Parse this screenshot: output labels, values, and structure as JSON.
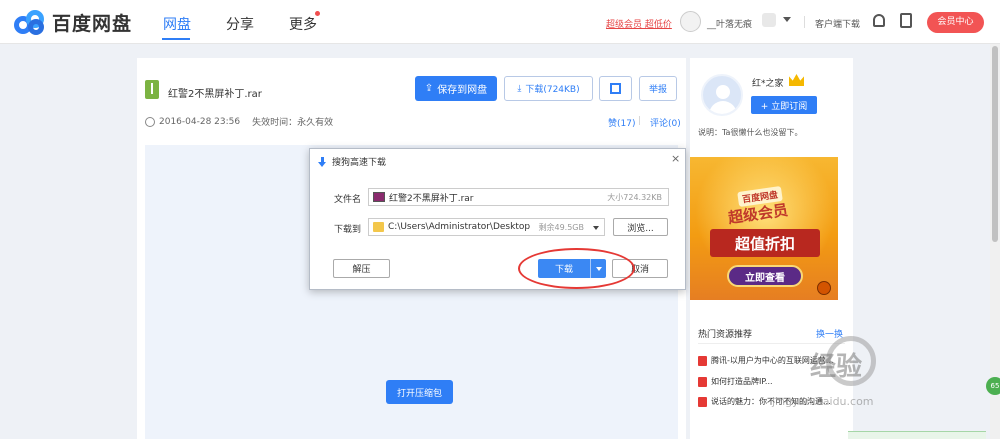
{
  "header": {
    "logo_text": "百度网盘",
    "tabs": [
      {
        "label": "网盘"
      },
      {
        "label": "分享"
      },
      {
        "label": "更多"
      }
    ],
    "vip_link": "超级会员 超低价",
    "username": "__叶落无痕",
    "client_download": "客户端下载",
    "vip_center": "会员中心"
  },
  "file": {
    "title": "红警2不黑屏补丁.rar",
    "save_button": "保存到网盘",
    "download_button": "下载(724KB)",
    "report_button": "举报",
    "date": "2016-04-28 23:56",
    "expiry": "失效时间：永久有效",
    "likes": "赞(17)",
    "comments": "评论(0)",
    "open_zip": "打开压缩包"
  },
  "dialog": {
    "title": "搜狗高速下载",
    "filename_label": "文件名",
    "filename": "红警2不黑屏补丁.rar",
    "size": "大小724.32KB",
    "save_to_label": "下载到",
    "path": "C:\\Users\\Administrator\\Desktop",
    "free_space": "剩余49.5GB",
    "browse": "浏览...",
    "unzip": "解压",
    "download": "下载",
    "cancel": "取消"
  },
  "sidebar": {
    "owner": "红*之家",
    "subscribe": "+ 立即订阅",
    "intro": "说明：Ta很懒什么也没留下。",
    "ad": {
      "tag": "百度网盘",
      "title": "超级会员",
      "banner": "超值折扣",
      "button": "立即查看"
    },
    "hot_title": "热门资源推荐",
    "hot_switch": "换一换",
    "hot_items": [
      "腾讯-以用户为中心的互联网运营...",
      "如何打造品牌IP...",
      "说话的魅力：你不可不知的沟通..."
    ]
  },
  "overlay": {
    "watermark": "经验",
    "watermark_url": "jingyan.baidu.com",
    "side_badge": "65"
  }
}
